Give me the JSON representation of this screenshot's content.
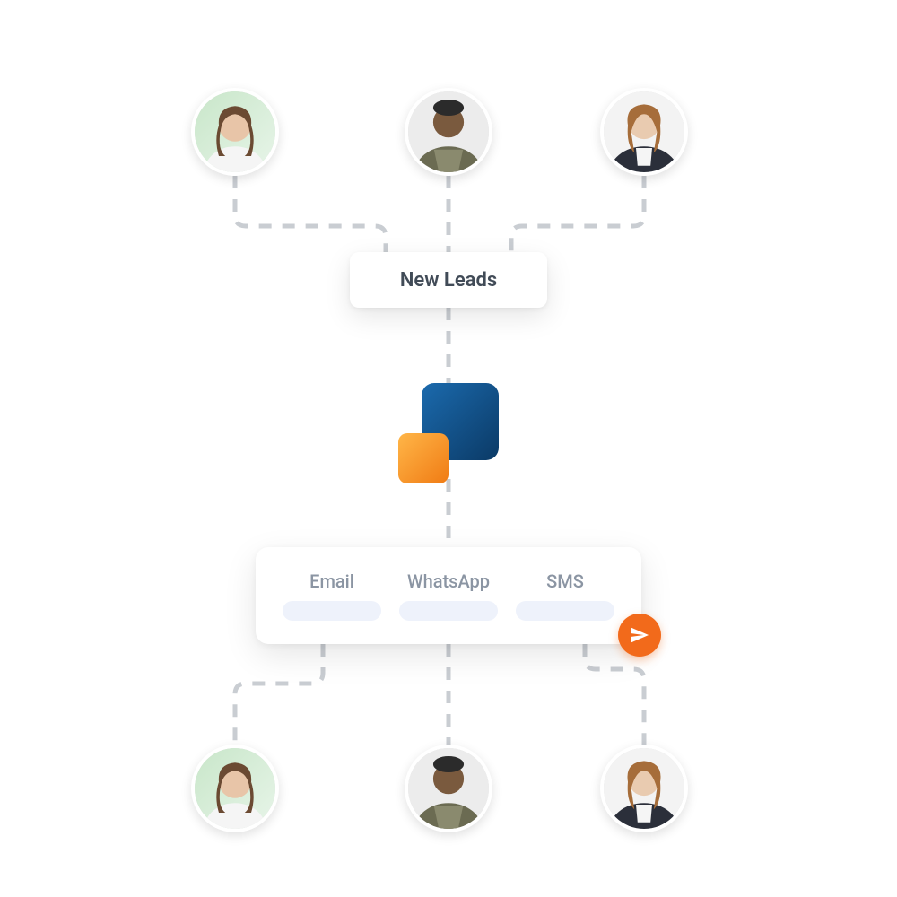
{
  "leads_card": {
    "label": "New Leads"
  },
  "channels": [
    {
      "label": "Email"
    },
    {
      "label": "WhatsApp"
    },
    {
      "label": "SMS"
    }
  ],
  "icons": {
    "send": "send-icon"
  },
  "avatars": {
    "top": [
      "lead-1",
      "lead-2",
      "lead-3"
    ],
    "bottom": [
      "recipient-1",
      "recipient-2",
      "recipient-3"
    ]
  },
  "colors": {
    "accent_orange": "#f26a1b",
    "logo_blue_start": "#1b6aad",
    "logo_blue_end": "#0b3a66",
    "logo_orange_start": "#ffb648",
    "logo_orange_end": "#f07b14",
    "pill_bg": "#eef2fb",
    "connector": "#c9cdd2"
  }
}
